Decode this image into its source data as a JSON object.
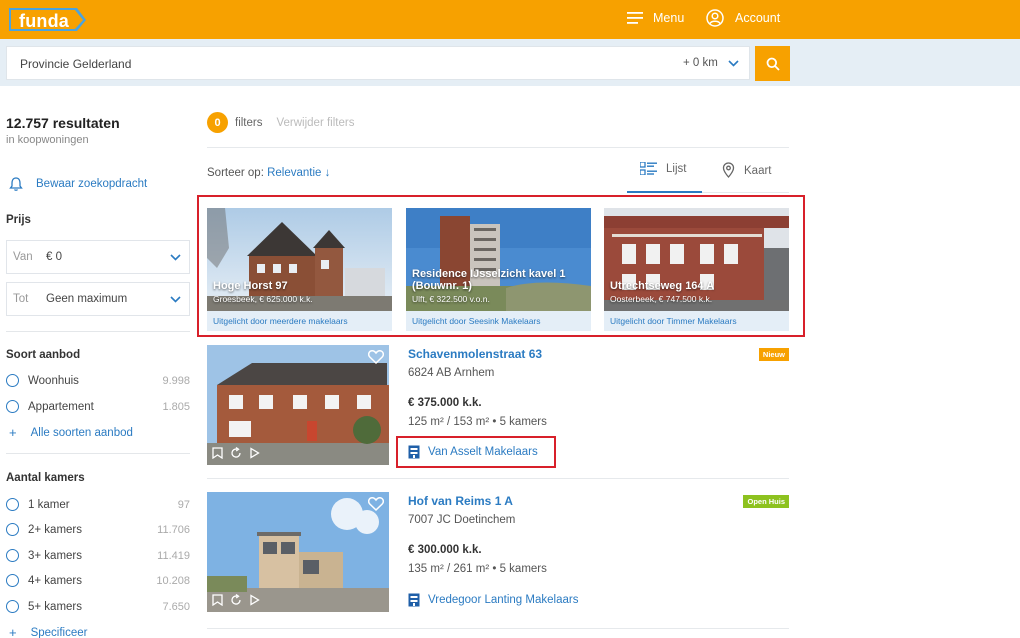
{
  "header": {
    "logo": "funda",
    "menu_label": "Menu",
    "account_label": "Account",
    "brand_color": "#f7a100"
  },
  "search": {
    "value": "Provincie Gelderland",
    "radius": "+ 0 km"
  },
  "sidebar": {
    "results_count": "12.757 resultaten",
    "results_sub": "in koopwoningen",
    "save_search": "Bewaar zoekopdracht",
    "price": {
      "title": "Prijs",
      "from_label": "Van",
      "from_value": "€ 0",
      "to_label": "Tot",
      "to_value": "Geen maximum"
    },
    "offer_type": {
      "title": "Soort aanbod",
      "options": [
        {
          "label": "Woonhuis",
          "count": "9.998"
        },
        {
          "label": "Appartement",
          "count": "1.805"
        }
      ],
      "more": "Alle soorten aanbod"
    },
    "rooms": {
      "title": "Aantal kamers",
      "options": [
        {
          "label": "1 kamer",
          "count": "97"
        },
        {
          "label": "2+ kamers",
          "count": "11.706"
        },
        {
          "label": "3+ kamers",
          "count": "11.419"
        },
        {
          "label": "4+ kamers",
          "count": "10.208"
        },
        {
          "label": "5+ kamers",
          "count": "7.650"
        }
      ],
      "more": "Specificeer"
    }
  },
  "filters": {
    "count": "0",
    "label": "filters",
    "remove": "Verwijder filters"
  },
  "sort": {
    "label": "Sorteer op:",
    "value": "Relevantie ↓"
  },
  "view": {
    "list_label": "Lijst",
    "map_label": "Kaart"
  },
  "featured": [
    {
      "title": "Hoge Horst 97",
      "sub": "Groesbeek, € 625.000 k.k.",
      "strip": "Uitgelicht door meerdere makelaars"
    },
    {
      "title": "Residence IJsselzicht kavel 1 (Bouwnr. 1)",
      "sub": "Ulft, € 322.500 v.o.n.",
      "strip": "Uitgelicht door Seesink Makelaars"
    },
    {
      "title": "Utrechtseweg 164 A",
      "sub": "Oosterbeek, € 747.500 k.k.",
      "strip": "Uitgelicht door Timmer Makelaars"
    }
  ],
  "listings": [
    {
      "address": "Schavenmolenstraat 63",
      "postal": "6824 AB Arnhem",
      "price": "€ 375.000 k.k.",
      "specs": "125 m² / 153 m² • 5 kamers",
      "agent": "Van Asselt Makelaars",
      "label": "Nieuw",
      "label_color": "#f7a100"
    },
    {
      "address": "Hof van Reims 1 A",
      "postal": "7007 JC Doetinchem",
      "price": "€ 300.000 k.k.",
      "specs": "135 m² / 261 m² • 5 kamers",
      "agent": "Vredegoor Lanting Makelaars",
      "label": "Open Huis",
      "label_color": "#8dc21f"
    }
  ]
}
